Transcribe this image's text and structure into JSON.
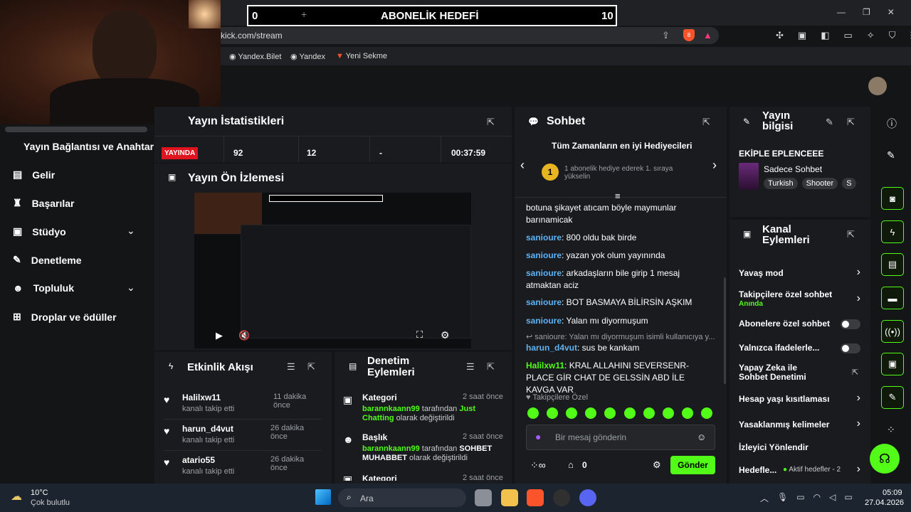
{
  "overlay": {
    "left": "0",
    "title": "ABONELİK HEDEFİ",
    "right": "10",
    "plus": "+"
  },
  "browser": {
    "url": "kick.com/stream",
    "bookmarks": [
      "Yandex.Bilet",
      "Yandex",
      "Yeni Sekme"
    ],
    "shield_count": "8"
  },
  "sidebar": {
    "connection": "Yayın Bağlantısı ve Anahtarı",
    "items": [
      {
        "label": "Gelir",
        "icon": "bars-icon"
      },
      {
        "label": "Başarılar",
        "icon": "trophy-icon"
      },
      {
        "label": "Stüdyo",
        "icon": "studio-icon"
      },
      {
        "label": "Denetleme",
        "icon": "wrench-icon"
      },
      {
        "label": "Topluluk",
        "icon": "people-icon"
      },
      {
        "label": "Droplar ve ödüller",
        "icon": "gift-icon"
      }
    ]
  },
  "stats": {
    "title": "Yayın İstatistikleri",
    "live": "YAYINDA",
    "viewers": "92",
    "followers": "12",
    "subs": "-",
    "time": "00:37:59"
  },
  "preview": {
    "title": "Yayın Ön İzlemesi"
  },
  "activity": {
    "title": "Etkinlik Akışı",
    "items": [
      {
        "user": "Halilxw11",
        "action": "kanalı takip etti",
        "time": "11 dakika önce"
      },
      {
        "user": "harun_d4vut",
        "action": "kanalı takip etti",
        "time": "26 dakika önce"
      },
      {
        "user": "atario55",
        "action": "kanalı takip etti",
        "time": "26 dakika önce"
      }
    ]
  },
  "modlog": {
    "title": "Denetim Eylemleri",
    "items": [
      {
        "label": "Kategori",
        "time": "2 saat önce",
        "user": "barannkaann99",
        "mid": "tarafından",
        "value": "Just Chatting",
        "tail": "olarak değiştirildi"
      },
      {
        "label": "Başlık",
        "time": "2 saat önce",
        "user": "barannkaann99",
        "mid": "tarafından",
        "value": "SOHBET MUHABBET",
        "tail": "olarak değiştirildi"
      },
      {
        "label": "Kategori",
        "time": "2 saat önce"
      }
    ]
  },
  "chat": {
    "title": "Sohbet",
    "gifters_title": "Tüm Zamanların en iyi Hediyecileri",
    "gift_rank": "1",
    "gift_text": "1 abonelik hediye ederek 1. sıraya yükselin",
    "messages": [
      {
        "user": "",
        "text": "botuna şikayet atıcam böyle maymunlar barınamicak"
      },
      {
        "user": "sanioure",
        "text": ": 800 oldu bak birde"
      },
      {
        "user": "sanioure",
        "text": ": yazan yok olum yayınında"
      },
      {
        "user": "sanioure",
        "text": ": arkadaşların bile girip 1 mesaj atmaktan aciz"
      },
      {
        "user": "sanioure",
        "text": ": BOT BASMAYA BİLİRSİN AŞKIM"
      },
      {
        "user": "sanioure",
        "text": ": Yalan mı diyormuşum"
      }
    ],
    "reply_ref": "sanioure: Yalan mı diyormuşum isimli kullanıcıya y...",
    "reply_user": "harun_d4vut",
    "reply_text": ": sus be kankam",
    "green_user": "Halilxw11",
    "green_text": ": KRAL ALLAHINI SEVERSENR-PLACE GİR CHAT DE GELSSİN ABD İLE KAVGA VAR",
    "followers_only": "Takipçilere Özel",
    "placeholder": "Bir mesaj gönderin",
    "points": "0",
    "send": "Gönder"
  },
  "info": {
    "title": "Yayın bilgisi",
    "stream_title": "EKİPLE EPLENCEEE",
    "category": "Sadece Sohbet",
    "tags": [
      "Turkish",
      "Shooter",
      "S"
    ]
  },
  "actions": {
    "title": "Kanal Eylemleri",
    "items": [
      {
        "label": "Yavaş mod"
      },
      {
        "label": "Takipçilere özel sohbet",
        "sub": "Anında"
      },
      {
        "label": "Abonelere özel sohbet"
      },
      {
        "label": "Yalnızca ifadelerle..."
      },
      {
        "label": "Yapay Zeka ile Sohbet Denetimi"
      },
      {
        "label": "Hesap yaşı kısıtlaması"
      },
      {
        "label": "Yasaklanmış kelimeler"
      },
      {
        "label": "İzleyici Yönlendir"
      },
      {
        "label": "Hedefle...",
        "sub": "Aktif hedefler - 2"
      }
    ]
  },
  "taskbar": {
    "temp": "10°C",
    "weather": "Çok bulutlu",
    "search": "Ara",
    "time": "05:09",
    "date": "27.04.2026"
  },
  "colors": {
    "accent": "#53fc18",
    "bg": "#141517",
    "panel": "#191b1f",
    "live": "#e0141e"
  }
}
